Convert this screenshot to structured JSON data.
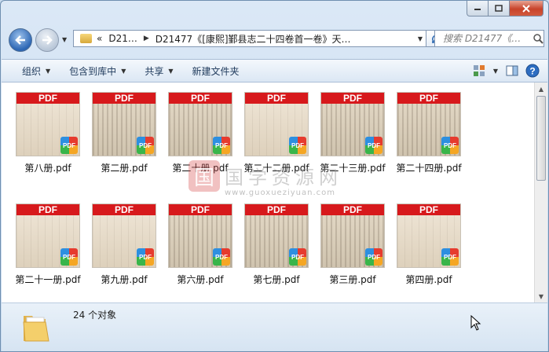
{
  "address": {
    "segments": [
      "D21…",
      "D21477《[康熙]鄞县志二十四卷首一卷》天…"
    ],
    "overflow": "«"
  },
  "search": {
    "placeholder": "搜索 D21477《…"
  },
  "toolbar": {
    "organize": "组织",
    "include_in_library": "包含到库中",
    "share": "共享",
    "new_folder": "新建文件夹"
  },
  "files": [
    {
      "name": "第八册.pdf",
      "thumb": "PDF",
      "badge": "PDF"
    },
    {
      "name": "第二册.pdf",
      "thumb": "PDF",
      "badge": "PDF"
    },
    {
      "name": "第二十册.pdf",
      "thumb": "PDF",
      "badge": "PDF"
    },
    {
      "name": "第二十二册.pdf",
      "thumb": "PDF",
      "badge": "PDF"
    },
    {
      "name": "第二十三册.pdf",
      "thumb": "PDF",
      "badge": "PDF"
    },
    {
      "name": "第二十四册.pdf",
      "thumb": "PDF",
      "badge": "PDF"
    },
    {
      "name": "第二十一册.pdf",
      "thumb": "PDF",
      "badge": "PDF"
    },
    {
      "name": "第九册.pdf",
      "thumb": "PDF",
      "badge": "PDF"
    },
    {
      "name": "第六册.pdf",
      "thumb": "PDF",
      "badge": "PDF"
    },
    {
      "name": "第七册.pdf",
      "thumb": "PDF",
      "badge": "PDF"
    },
    {
      "name": "第三册.pdf",
      "thumb": "PDF",
      "badge": "PDF"
    },
    {
      "name": "第四册.pdf",
      "thumb": "PDF",
      "badge": "PDF"
    }
  ],
  "watermark": {
    "logo": "国",
    "title": "国学资源网",
    "url": "www.guoxueziyuan.com"
  },
  "status": {
    "count": "24 个对象"
  },
  "colors": {
    "pdf_band": "#d7191c",
    "toolbar_text": "#1e395b"
  }
}
